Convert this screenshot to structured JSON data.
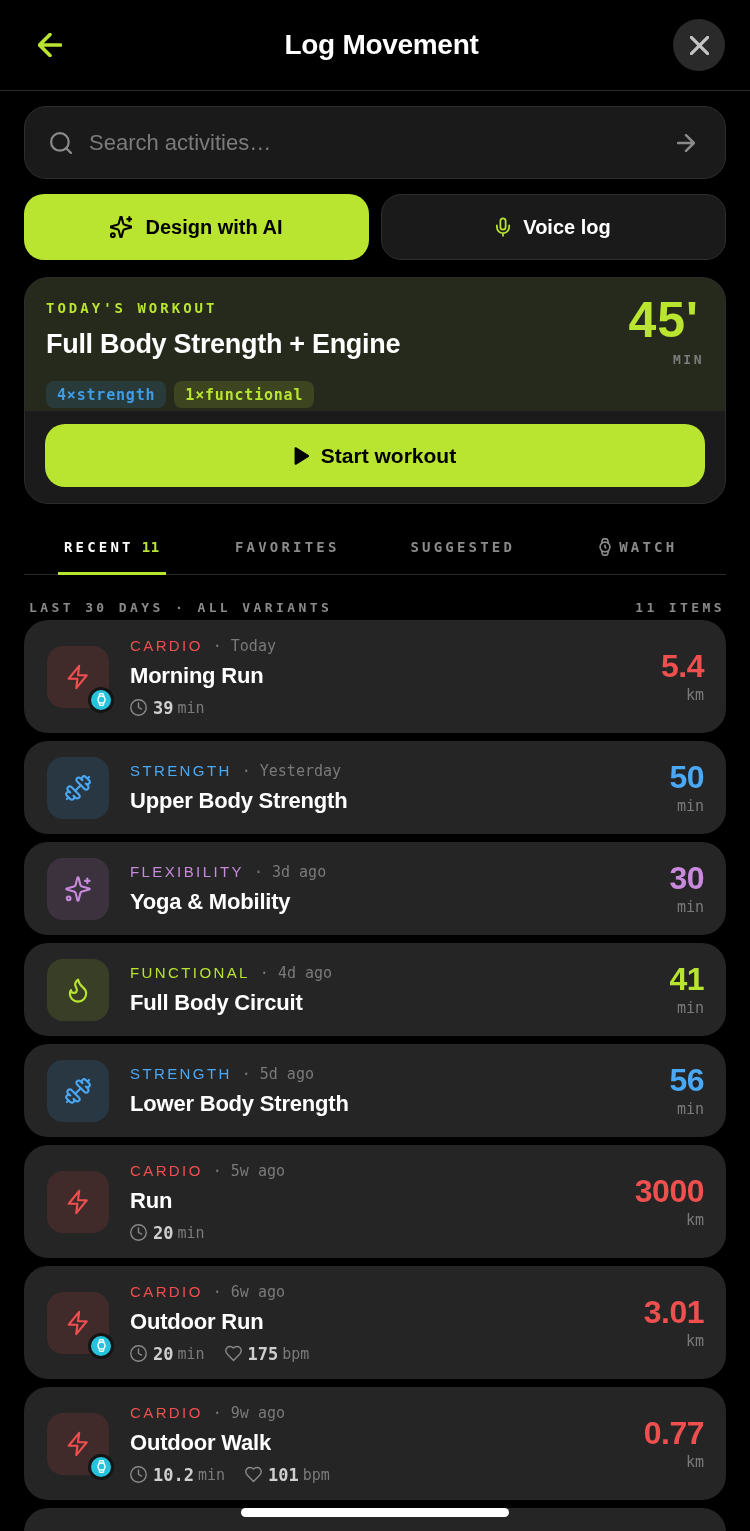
{
  "header": {
    "title": "Log Movement"
  },
  "search": {
    "placeholder": "Search activities…"
  },
  "actions": [
    {
      "kind": "ai",
      "label": "Design with AI"
    },
    {
      "kind": "voice",
      "label": "Voice log"
    }
  ],
  "workout": {
    "eyebrow": "TODAY'S WORKOUT",
    "title": "Full Body Strength + Engine",
    "duration": "45'",
    "unit": "MIN",
    "tags": [
      {
        "label": "4×strength",
        "color": "#3f9ce6"
      },
      {
        "label": "1×functional",
        "color": "#b9e530"
      }
    ],
    "button": "Start workout"
  },
  "tabs": [
    {
      "kind": "text",
      "label": "RECENT",
      "count": "11",
      "selected": true
    },
    {
      "kind": "text",
      "label": "FAVORITES",
      "selected": false
    },
    {
      "kind": "text",
      "label": "SUGGESTED",
      "selected": false
    },
    {
      "kind": "watch",
      "label": "WATCH",
      "selected": false
    }
  ],
  "list_header": {
    "filter": "LAST 30 DAYS · ALL VARIANTS",
    "count": "11 ITEMS"
  },
  "activities": [
    {
      "category": "CARDIO",
      "kind": "cardio",
      "color": "#f04f4f",
      "when": "· Today",
      "name": "Morning Run",
      "watch_synced": true,
      "duration": "39",
      "duration_unit": "min",
      "value": "5.4",
      "unit": "km"
    },
    {
      "category": "STRENGTH",
      "kind": "strength",
      "color": "#4aa8f5",
      "when": "· Yesterday",
      "name": "Upper Body Strength",
      "watch_synced": false,
      "value": "50",
      "unit": "min"
    },
    {
      "category": "FLEXIBILITY",
      "kind": "flexibility",
      "color": "#c98ade",
      "when": "· 3d ago",
      "name": "Yoga & Mobility",
      "watch_synced": false,
      "value": "30",
      "unit": "min"
    },
    {
      "category": "FUNCTIONAL",
      "kind": "functional",
      "color": "#b9e530",
      "when": "· 4d ago",
      "name": "Full Body Circuit",
      "watch_synced": false,
      "value": "41",
      "unit": "min"
    },
    {
      "category": "STRENGTH",
      "kind": "strength",
      "color": "#4aa8f5",
      "when": "· 5d ago",
      "name": "Lower Body Strength",
      "watch_synced": false,
      "value": "56",
      "unit": "min"
    },
    {
      "category": "CARDIO",
      "kind": "cardio",
      "color": "#f04f4f",
      "when": "· 5w ago",
      "name": "Run",
      "watch_synced": false,
      "duration": "20",
      "duration_unit": "min",
      "value": "3000",
      "unit": "km"
    },
    {
      "category": "CARDIO",
      "kind": "cardio",
      "color": "#f04f4f",
      "when": "· 6w ago",
      "name": "Outdoor Run",
      "watch_synced": true,
      "duration": "20",
      "duration_unit": "min",
      "heart_rate": "175",
      "heart_rate_unit": "bpm",
      "value": "3.01",
      "unit": "km"
    },
    {
      "category": "CARDIO",
      "kind": "cardio",
      "color": "#f04f4f",
      "when": "· 9w ago",
      "name": "Outdoor Walk",
      "watch_synced": true,
      "duration": "10.2",
      "duration_unit": "min",
      "heart_rate": "101",
      "heart_rate_unit": "bpm",
      "value": "0.77",
      "unit": "km"
    }
  ],
  "activities_more_below": true
}
